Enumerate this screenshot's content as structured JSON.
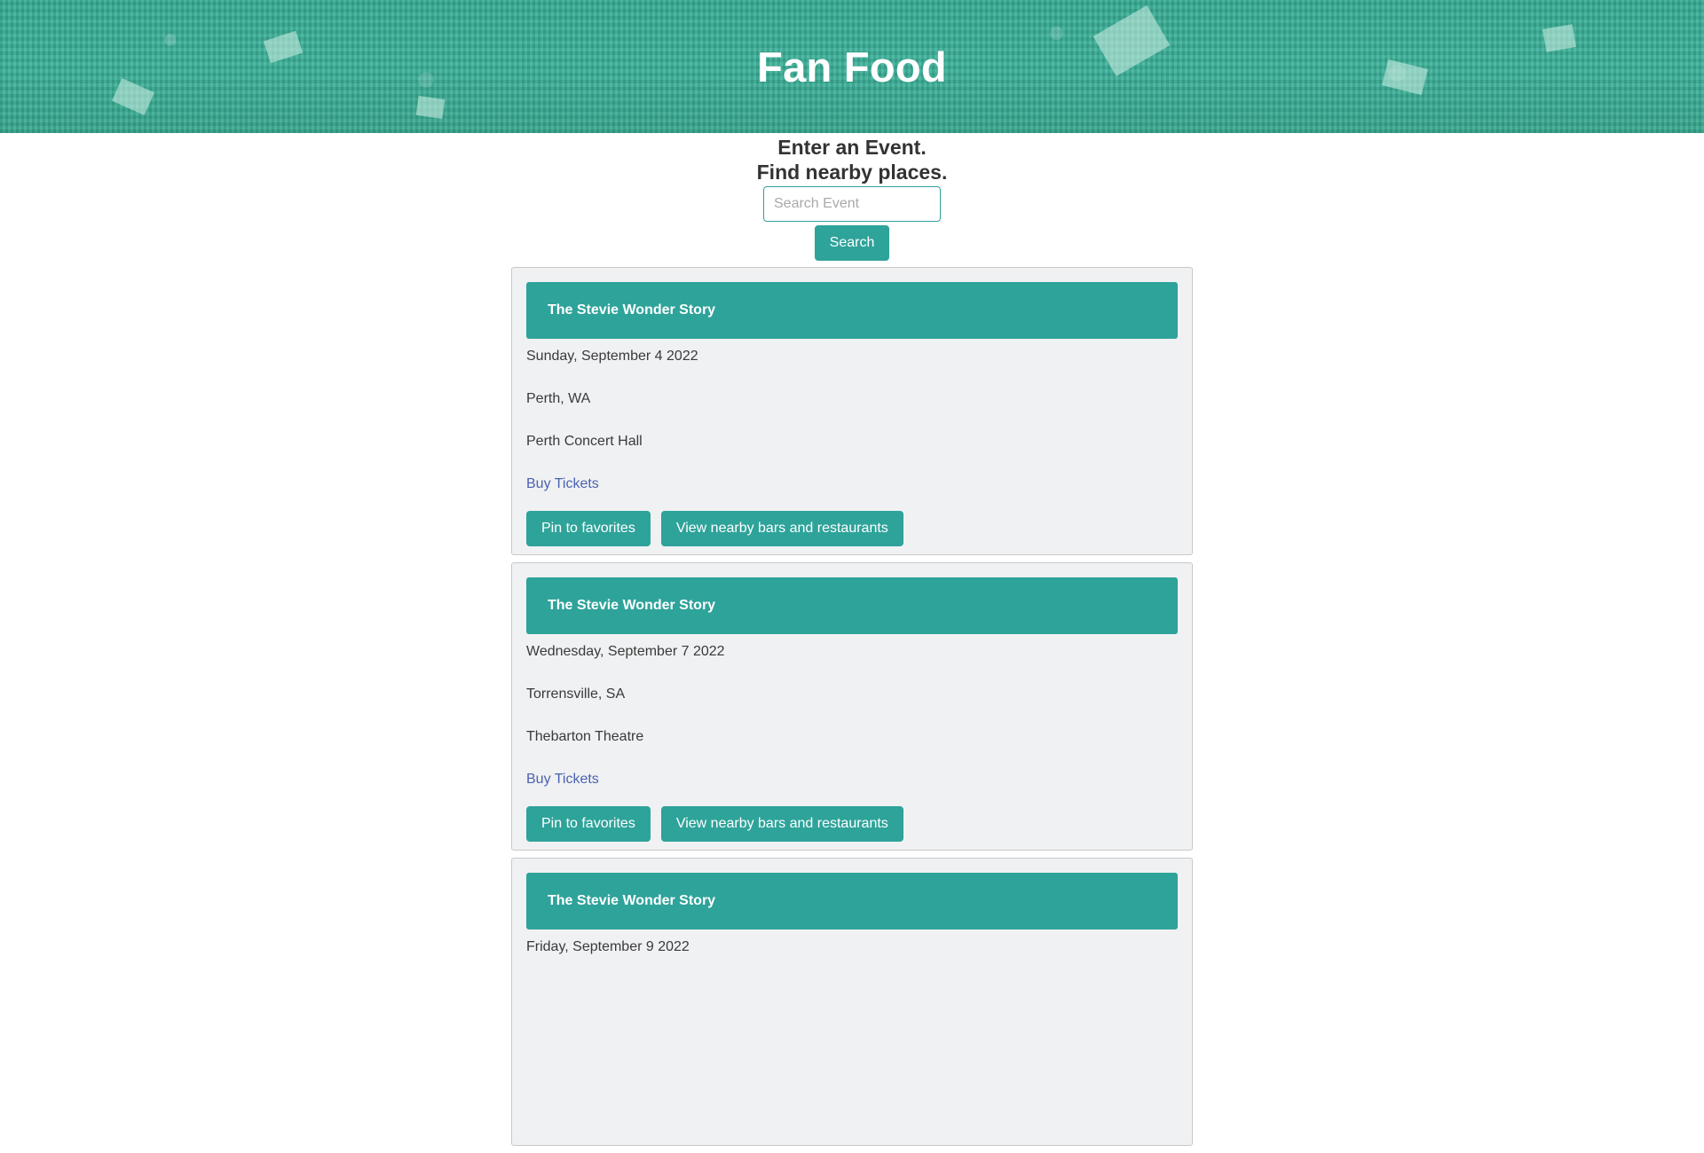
{
  "header": {
    "title": "Fan Food"
  },
  "search": {
    "tagline_line1": "Enter an Event.",
    "tagline_line2": "Find nearby places.",
    "placeholder": "Search Event",
    "button_label": "Search"
  },
  "events": [
    {
      "name": "The Stevie Wonder Story",
      "date": "Sunday, September 4 2022",
      "location": "Perth, WA",
      "venue": "Perth Concert Hall",
      "tickets_label": "Buy Tickets",
      "pin_label": "Pin to favorites",
      "nearby_label": "View nearby bars and restaurants"
    },
    {
      "name": "The Stevie Wonder Story",
      "date": "Wednesday, September 7 2022",
      "location": "Torrensville, SA",
      "venue": "Thebarton Theatre",
      "tickets_label": "Buy Tickets",
      "pin_label": "Pin to favorites",
      "nearby_label": "View nearby bars and restaurants"
    },
    {
      "name": "The Stevie Wonder Story",
      "date": "Friday, September 9 2022",
      "location": "",
      "venue": "",
      "tickets_label": "",
      "pin_label": "",
      "nearby_label": ""
    }
  ],
  "colors": {
    "accent": "#2ea39a",
    "hero": "#40b39c",
    "link": "#4a62b0",
    "card_bg": "#f0f1f3"
  }
}
